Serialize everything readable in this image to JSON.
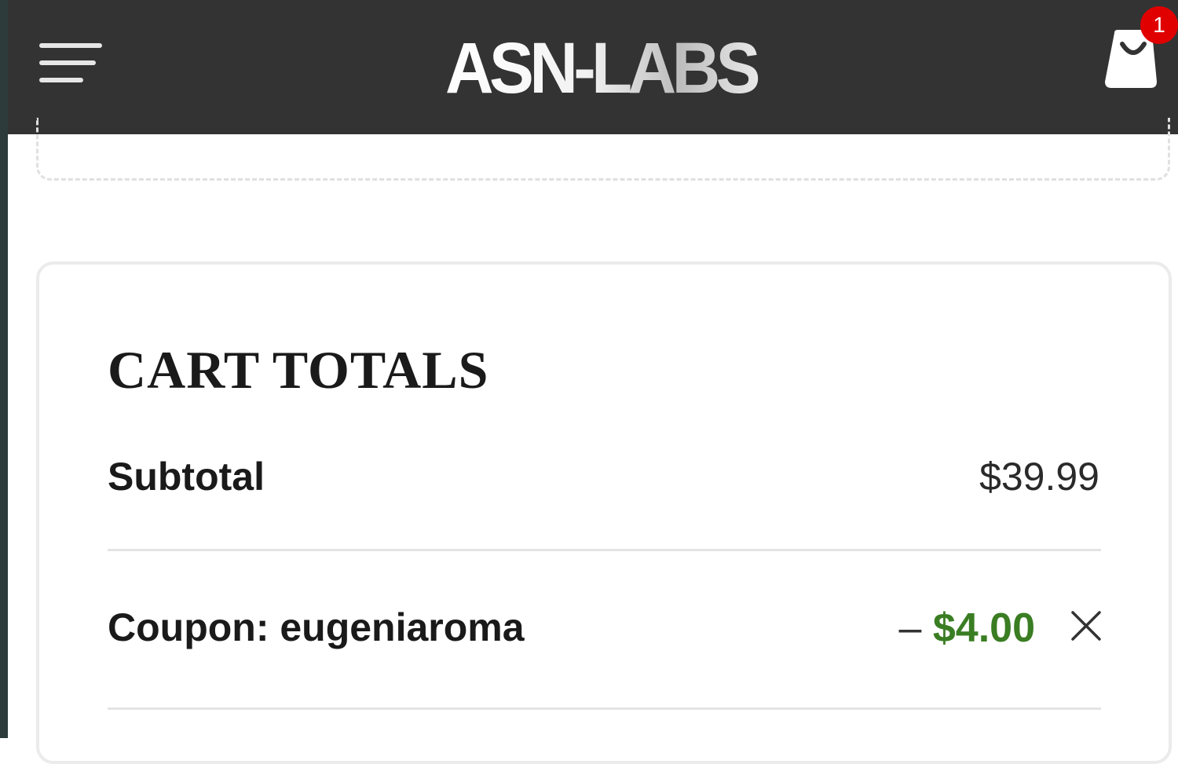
{
  "header": {
    "logo_text": "ASN-LABS",
    "cart_count": "1"
  },
  "cart_totals": {
    "title": "CART TOTALS",
    "subtotal_label": "Subtotal",
    "subtotal_value": "$39.99",
    "coupon_label": "Coupon: eugeniaroma",
    "coupon_dash": "–",
    "coupon_value": "$4.00"
  },
  "colors": {
    "header_bg": "#333333",
    "discount_green": "#3a7d23",
    "badge_red": "#e00000"
  },
  "icons": {
    "menu": "hamburger-menu-icon",
    "cart": "shopping-bag-icon",
    "remove": "close-icon"
  }
}
